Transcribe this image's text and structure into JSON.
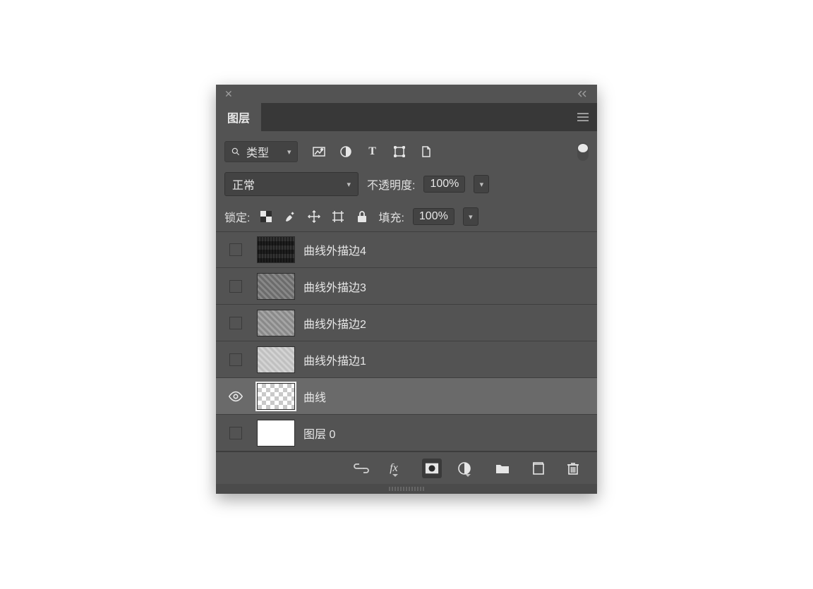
{
  "header": {
    "tab_label": "图层"
  },
  "filter": {
    "type_label": "类型"
  },
  "blend": {
    "mode": "正常",
    "opacity_label": "不透明度:",
    "opacity_value": "100%"
  },
  "lock": {
    "label": "锁定:",
    "fill_label": "填充:",
    "fill_value": "100%"
  },
  "layers": [
    {
      "name": "曲线外描边4",
      "thumb": "dark",
      "visible": false,
      "selected": false
    },
    {
      "name": "曲线外描边3",
      "thumb": "mid",
      "visible": false,
      "selected": false
    },
    {
      "name": "曲线外描边2",
      "thumb": "midlt",
      "visible": false,
      "selected": false
    },
    {
      "name": "曲线外描边1",
      "thumb": "ltr",
      "visible": false,
      "selected": false
    },
    {
      "name": "曲线",
      "thumb": "checker",
      "visible": true,
      "selected": true
    },
    {
      "name": "图层 0",
      "thumb": "white",
      "visible": false,
      "selected": false
    }
  ]
}
